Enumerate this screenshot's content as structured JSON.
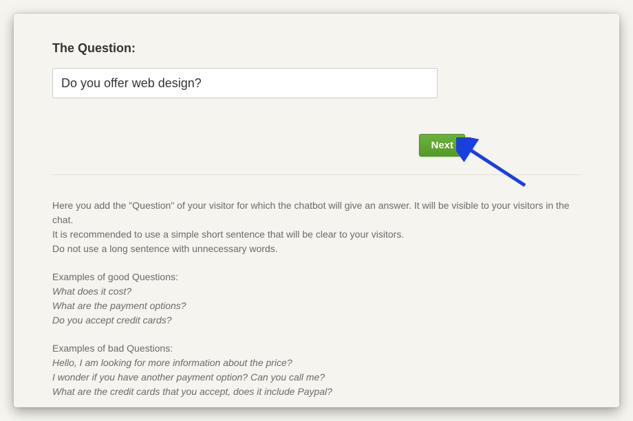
{
  "form": {
    "title": "The Question:",
    "question_value": "Do you offer web design?",
    "next_label": "Next"
  },
  "help": {
    "intro_line1": "Here you add the \"Question\" of your visitor for which the chatbot will give an answer. It will be visible to your visitors in the chat.",
    "intro_line2": "It is recommended to use a simple short sentence that will be clear to your visitors.",
    "intro_line3": "Do not use a long sentence with unnecessary words.",
    "good_label": "Examples of good Questions:",
    "good_examples": [
      "What does it cost?",
      "What are the payment options?",
      "Do you accept credit cards?"
    ],
    "bad_label": "Examples of bad Questions:",
    "bad_examples": [
      "Hello, I am looking for more information about the price?",
      "I wonder if you have another payment option? Can you call me?",
      "What are the credit cards that you accept, does it include Paypal?"
    ]
  },
  "colors": {
    "accent": "#5fa72f",
    "arrow": "#1a3fe0"
  }
}
